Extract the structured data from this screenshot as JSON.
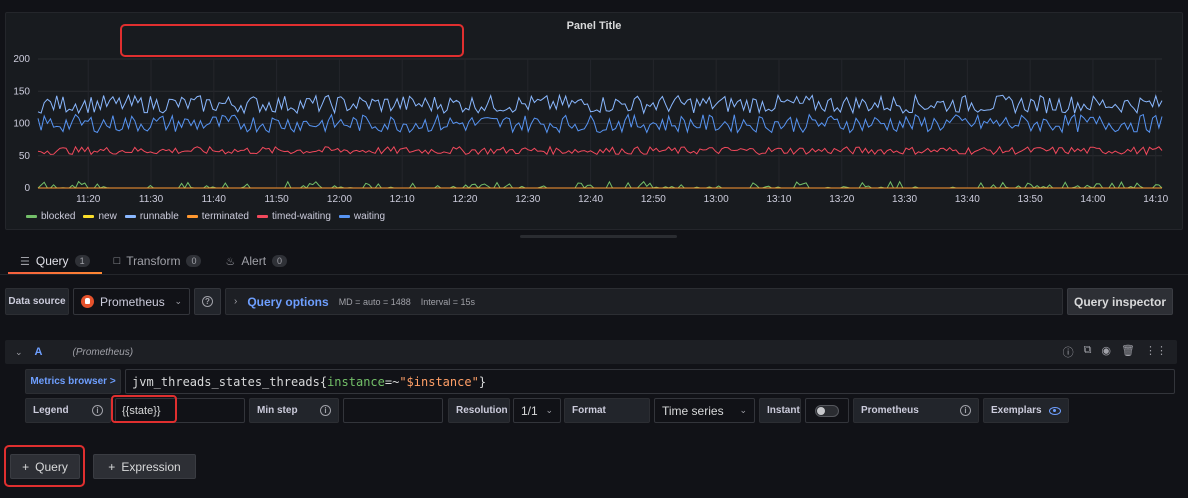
{
  "panel": {
    "title": "Panel Title"
  },
  "chart_data": {
    "type": "line",
    "title": "Panel Title",
    "x_ticks": [
      "11:20",
      "11:30",
      "11:40",
      "11:50",
      "12:00",
      "12:10",
      "12:20",
      "12:30",
      "12:40",
      "12:50",
      "13:00",
      "13:10",
      "13:20",
      "13:30",
      "13:40",
      "13:50",
      "14:00",
      "14:10"
    ],
    "xlim": [
      "11:12",
      "14:11"
    ],
    "ylim": [
      0,
      200
    ],
    "y_ticks": [
      0,
      50,
      100,
      150,
      200
    ],
    "grid": true,
    "legend_position": "bottom-left",
    "series": [
      {
        "name": "blocked",
        "color": "#73bf69",
        "mean": 2,
        "noise": 4
      },
      {
        "name": "new",
        "color": "#fade2a",
        "mean": 0,
        "noise": 0
      },
      {
        "name": "runnable",
        "color": "#8ab8ff",
        "mean": 130,
        "noise": 14
      },
      {
        "name": "terminated",
        "color": "#ff9830",
        "mean": 0,
        "noise": 0
      },
      {
        "name": "timed-waiting",
        "color": "#f2495c",
        "mean": 58,
        "noise": 6
      },
      {
        "name": "waiting",
        "color": "#5794f2",
        "mean": 100,
        "noise": 14
      }
    ]
  },
  "tabs": [
    {
      "label": "Query",
      "count": "1"
    },
    {
      "label": "Transform",
      "count": "0"
    },
    {
      "label": "Alert",
      "count": "0"
    }
  ],
  "datasource": {
    "label": "Data source",
    "selected": "Prometheus",
    "query_options_label": "Query options",
    "md": "MD = auto = 1488",
    "interval": "Interval = 15s",
    "inspector_label": "Query inspector"
  },
  "query_a": {
    "letter": "A",
    "datasource": "(Prometheus)",
    "metrics_browser": "Metrics browser >",
    "expr_metric": "jvm_threads_states_threads{",
    "expr_label": "instance",
    "expr_op": "=~",
    "expr_value": "\"$instance\"",
    "expr_close": "}",
    "legend_label": "Legend",
    "legend_value": "{{state}}",
    "min_step_label": "Min step",
    "min_step_value": "",
    "resolution_label": "Resolution",
    "resolution_value": "1/1",
    "format_label": "Format",
    "format_value": "Time series",
    "instant_label": "Instant",
    "prometheus_label": "Prometheus",
    "exemplars_label": "Exemplars"
  },
  "buttons": {
    "add_query": "Query",
    "add_expression": "Expression"
  }
}
